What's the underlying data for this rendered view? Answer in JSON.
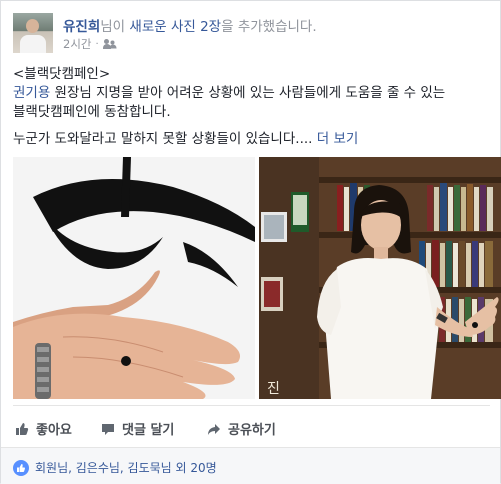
{
  "post": {
    "author": "유진희",
    "action_text": "님이 새로운 사진 2장을 추가했습니다.",
    "photos_link": "새로운 사진 2장",
    "action_prefix": "님이 ",
    "action_suffix": "을 추가했습니다.",
    "time": "2시간",
    "separator": "·",
    "privacy_icon": "friends-icon"
  },
  "body": {
    "line1": "<블랙닷캠페인>",
    "tag": "권기용",
    "line2_rest": " 원장님 지명을 받아 어려운 상황에 있는 사람들에게 도움을 줄 수 있는",
    "line3": "블랙닷캠페인에 동참합니다.",
    "line4": "누군가 도와달라고 말하지 못할 상황들이 있습니다.... ",
    "more": "더 보기"
  },
  "photos": [
    {
      "name": "hand-with-black-dot-photo"
    },
    {
      "name": "woman-showing-hand-photo",
      "caption_text": "진"
    }
  ],
  "actions": {
    "like": "좋아요",
    "comment": "댓글 달기",
    "share": "공유하기"
  },
  "likes": {
    "summary": "회원님, 김은수님, 김도묵님 외 20명"
  },
  "colors": {
    "link": "#365899",
    "text": "#1d2129",
    "muted": "#90949c",
    "like_badge": "#5890ff"
  }
}
